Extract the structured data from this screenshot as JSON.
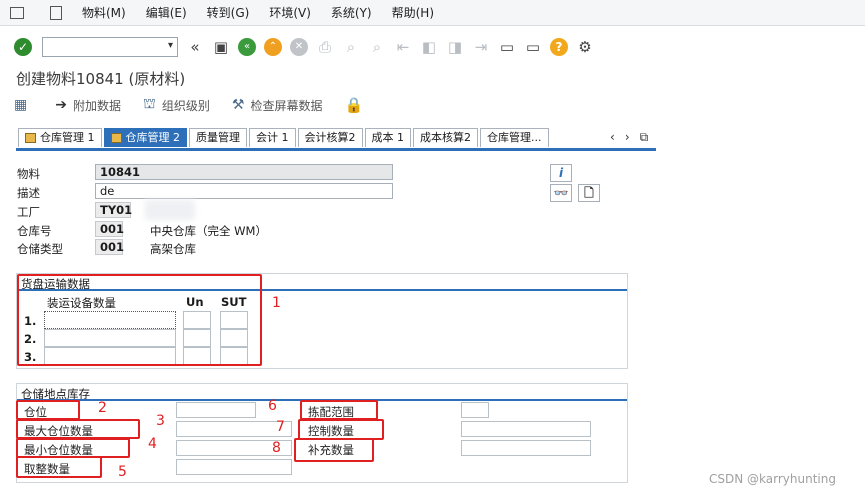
{
  "menu": {
    "items": [
      "物料(M)",
      "编辑(E)",
      "转到(G)",
      "环境(V)",
      "系统(Y)",
      "帮助(H)"
    ]
  },
  "toolbar": {
    "command_value": "",
    "icons": [
      "checkmark-icon",
      "double-left-icon",
      "save-icon",
      "back-icon",
      "exit-icon",
      "cancel-icon",
      "print-icon",
      "find-icon",
      "find-next-icon",
      "first-page-icon",
      "prev-page-icon",
      "next-page-icon",
      "last-page-icon",
      "new-session-icon",
      "shortcut-icon",
      "help-icon",
      "settings-icon"
    ]
  },
  "title": "创建物料10841 (原材料)",
  "app_toolbar": {
    "additional_data": "附加数据",
    "org_levels": "组织级别",
    "check_screen": "检查屏幕数据"
  },
  "tabs": [
    "仓库管理 1",
    "仓库管理 2",
    "质量管理",
    "会计 1",
    "会计核算2",
    "成本 1",
    "成本核算2",
    "仓库管理..."
  ],
  "active_tab": 1,
  "tab_nav": [
    "‹",
    "›",
    "⧉"
  ],
  "header": {
    "material_label": "物料",
    "material_value": "10841",
    "desc_label": "描述",
    "desc_value": "de",
    "plant_label": "工厂",
    "plant_value": "TY01",
    "whno_label": "仓库号",
    "whno_value": "001",
    "whno_text": "中央仓库（完全 WM）",
    "sttype_label": "仓储类型",
    "sttype_value": "001",
    "sttype_text": "高架仓库"
  },
  "side_buttons": {
    "info": "i",
    "glasses": "👓",
    "doc": "🗋"
  },
  "palletization": {
    "title": "货盘运输数据",
    "col1": "装运设备数量",
    "col2": "Un",
    "col3": "SUT",
    "rows": [
      "1.",
      "2.",
      "3."
    ]
  },
  "storage_bin": {
    "title": "仓储地点库存",
    "storage_bin": "仓位",
    "max_bin_qty": "最大仓位数量",
    "min_bin_qty": "最小仓位数量",
    "rounding_qty": "取整数量",
    "picking_area": "拣配范围",
    "control_qty": "控制数量",
    "replenish_qty": "补充数量"
  },
  "annotations": [
    "1",
    "2",
    "3",
    "4",
    "5",
    "6",
    "7",
    "8"
  ],
  "watermark": "CSDN @karryhunting"
}
